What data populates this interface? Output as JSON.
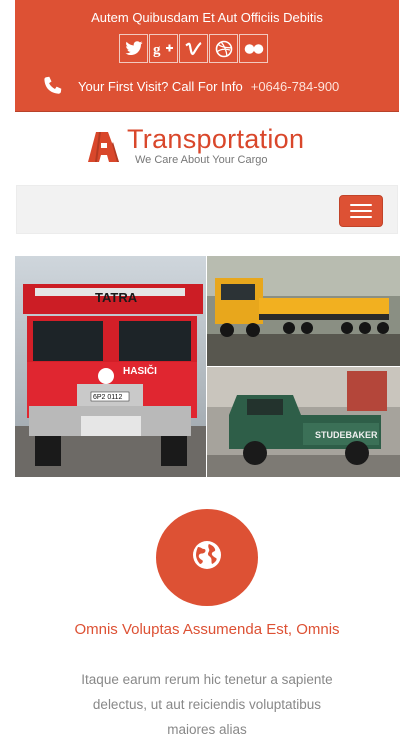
{
  "header": {
    "tagline": "Autem Quibusdam Et Aut Officiis Debitis",
    "social": [
      "twitter-icon",
      "google-plus-icon",
      "vimeo-icon",
      "dribbble-icon",
      "flickr-icon"
    ],
    "call_text": "Your First Visit? Call For Info",
    "phone": "+0646-784-900"
  },
  "brand": {
    "name": "Transportation",
    "tagline": "We Care About Your Cargo"
  },
  "nav": {
    "toggle_icon": "menu-icon"
  },
  "gallery": {
    "photos": [
      "fire-truck-photo",
      "heavy-haul-truck-photo",
      "vintage-pickup-photo"
    ],
    "truck_labels": {
      "brand": "TATRA",
      "station": "HASIČI",
      "plate": "6P2 0112",
      "pickup": "STUDEBAKER"
    }
  },
  "feature": {
    "icon": "globe-icon",
    "title": "Omnis Voluptas Assumenda Est, Omnis",
    "text": "Itaque earum rerum hic tenetur a sapiente delectus, ut aut reiciendis voluptatibus maiores alias"
  },
  "colors": {
    "accent": "#dd5134",
    "nav_bg": "#f2f2f2"
  }
}
